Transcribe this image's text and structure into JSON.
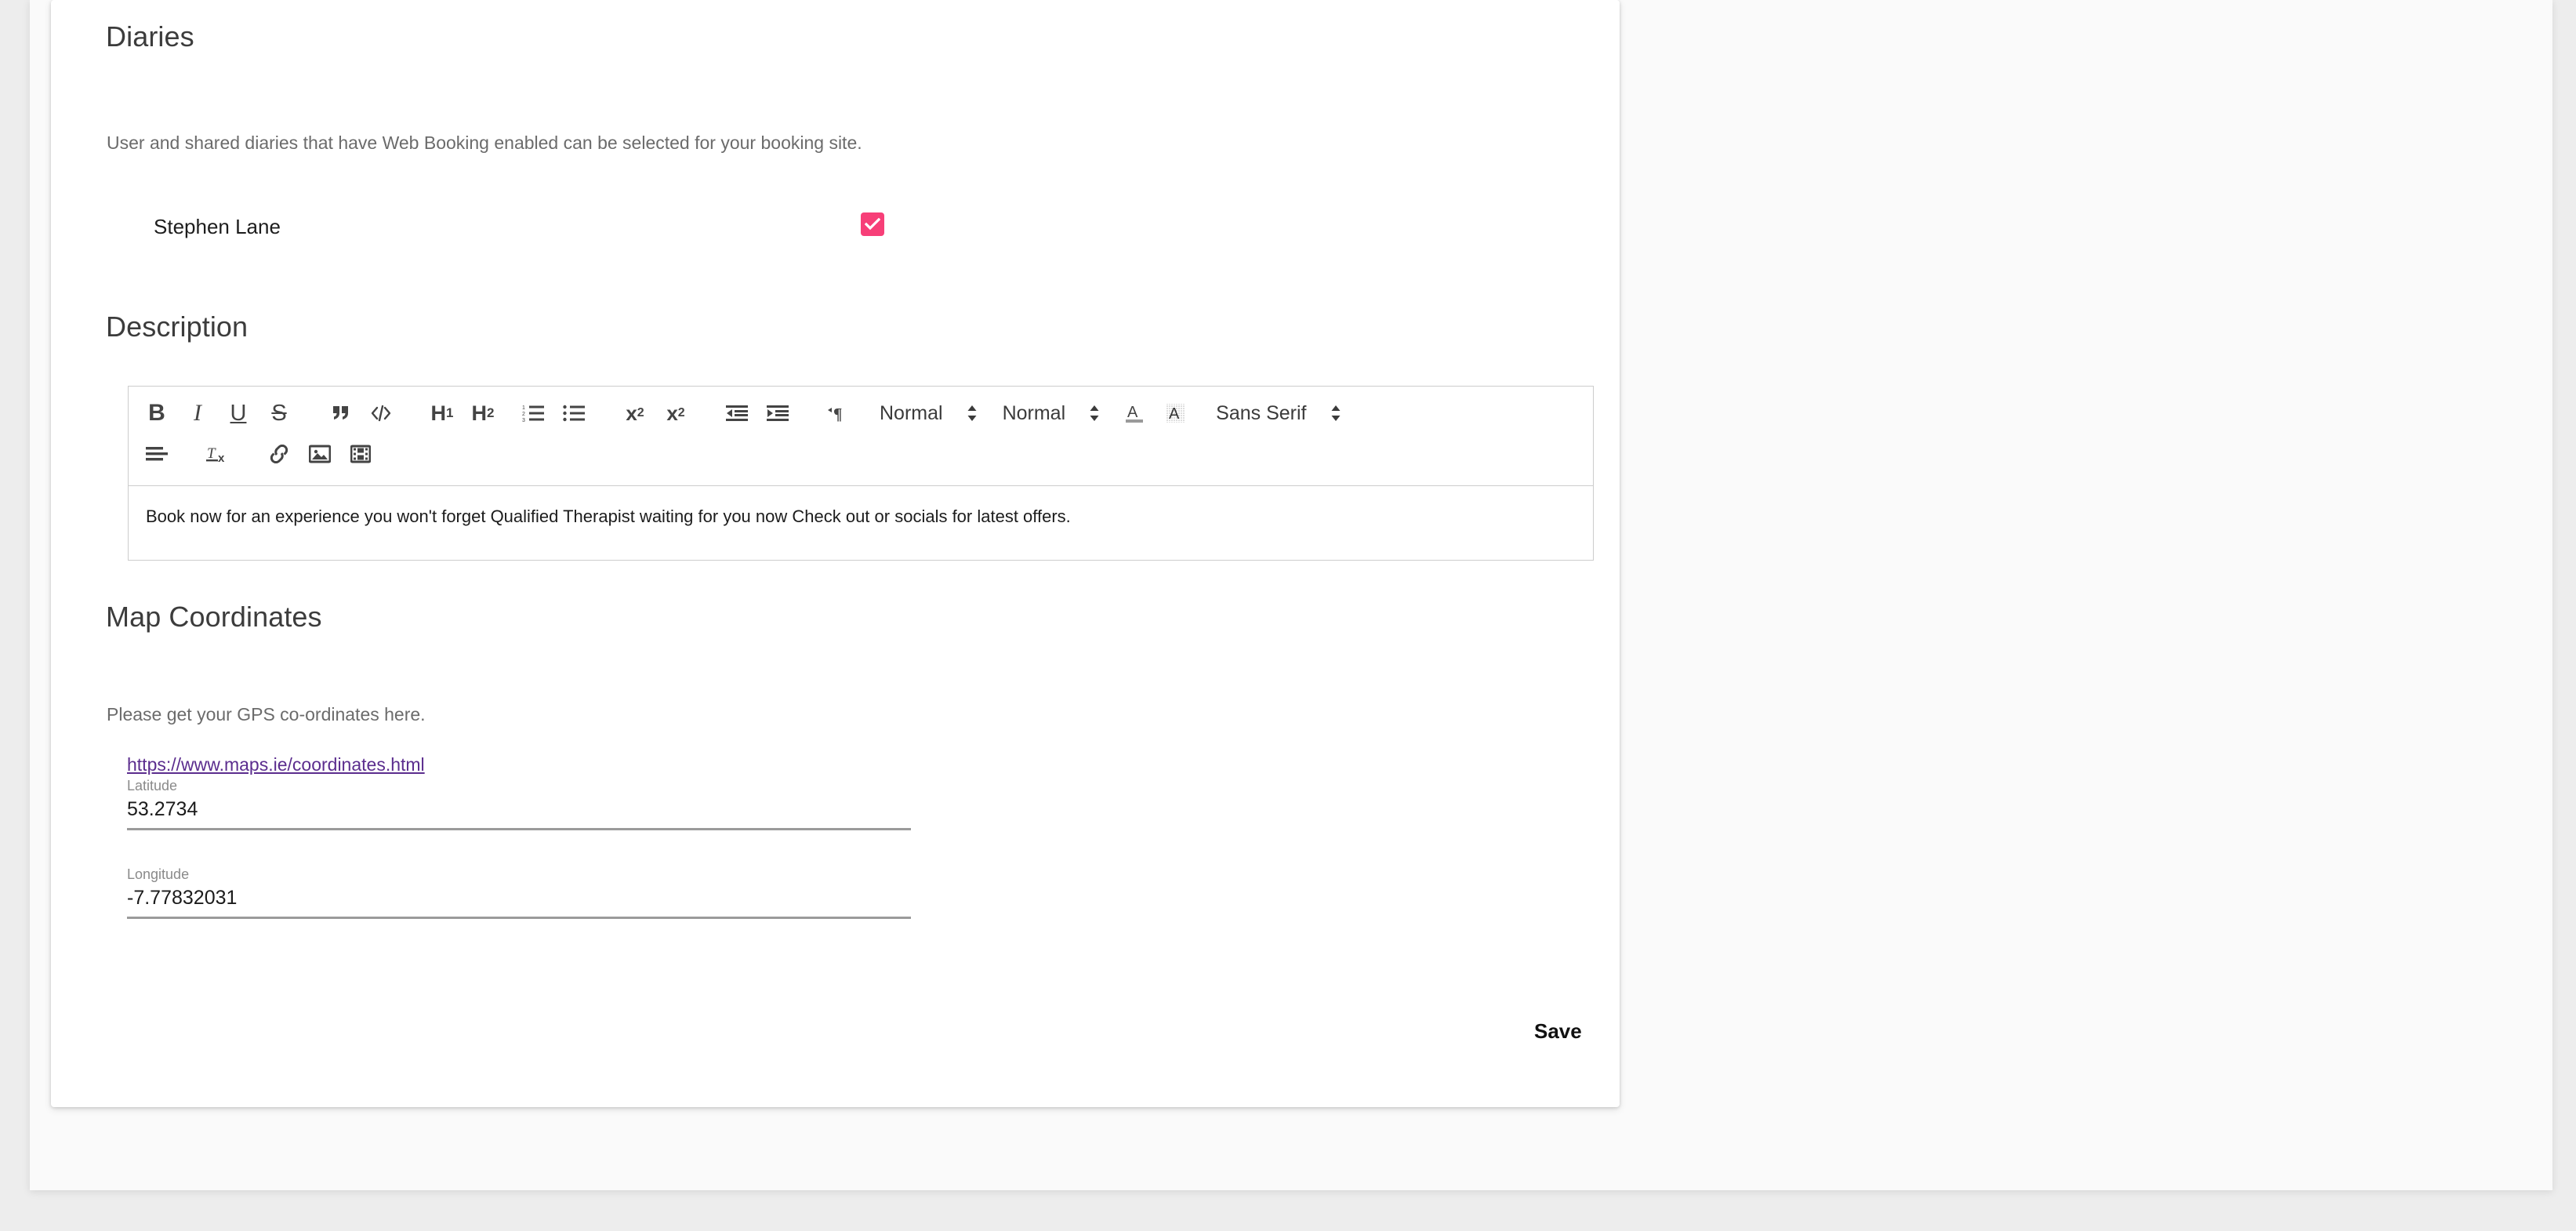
{
  "theme": {
    "accent_pink": "#f73f78",
    "link_purple": "#5b2d8e",
    "page_background": "#ededed",
    "panel_background": "#fafafa",
    "card_background": "#ffffff"
  },
  "diaries": {
    "heading": "Diaries",
    "help_text": "User and shared diaries that have Web Booking enabled can be selected for your booking site.",
    "rows": [
      {
        "name": "Stephen Lane",
        "checked": true
      }
    ]
  },
  "description": {
    "heading": "Description",
    "content": "Book now for an experience you won't forget Qualified Therapist waiting for you now Check out or socials for latest offers.",
    "toolbar": {
      "row1": [
        {
          "icon": "bold-icon",
          "label": "B"
        },
        {
          "icon": "italic-icon",
          "label": "I"
        },
        {
          "icon": "underline-icon",
          "label": "U"
        },
        {
          "icon": "strikethrough-icon",
          "label": "S"
        },
        {
          "icon": "blockquote-icon",
          "label": "”"
        },
        {
          "icon": "code-block-icon",
          "label": "</>"
        },
        {
          "icon": "heading-1-icon",
          "label": "H1"
        },
        {
          "icon": "heading-2-icon",
          "label": "H2"
        },
        {
          "icon": "ordered-list-icon",
          "label": ""
        },
        {
          "icon": "bullet-list-icon",
          "label": ""
        },
        {
          "icon": "subscript-icon",
          "label": "x2"
        },
        {
          "icon": "superscript-icon",
          "label": "x2"
        },
        {
          "icon": "outdent-icon",
          "label": ""
        },
        {
          "icon": "indent-icon",
          "label": ""
        },
        {
          "icon": "text-direction-icon",
          "label": "¶"
        }
      ],
      "row2": [
        {
          "icon": "align-icon",
          "label": ""
        },
        {
          "icon": "clear-formatting-icon",
          "label": "Tx"
        },
        {
          "icon": "link-icon",
          "label": ""
        },
        {
          "icon": "image-icon",
          "label": ""
        },
        {
          "icon": "video-icon",
          "label": ""
        }
      ],
      "selects": [
        {
          "name": "header-select",
          "value": "Normal"
        },
        {
          "name": "size-select",
          "value": "Normal"
        },
        {
          "name": "font-select",
          "value": "Sans Serif"
        }
      ],
      "color_buttons": [
        {
          "icon": "text-color-icon",
          "label": "A"
        },
        {
          "icon": "background-color-icon",
          "label": "A"
        }
      ]
    }
  },
  "map_coordinates": {
    "heading": "Map Coordinates",
    "help_text": "Please get your GPS co-ordinates here.",
    "link_text": "https://www.maps.ie/coordinates.html",
    "fields": [
      {
        "label": "Latitude",
        "value": "53.2734"
      },
      {
        "label": "Longitude",
        "value": "-7.77832031"
      }
    ]
  },
  "actions": {
    "save_label": "Save"
  }
}
